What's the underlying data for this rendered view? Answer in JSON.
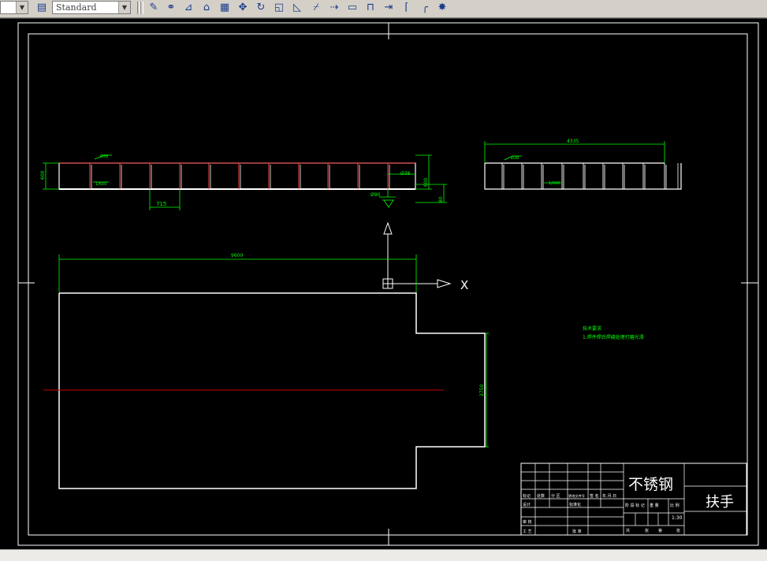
{
  "toolbar": {
    "text_style_value": "Standard",
    "icons": [
      "text-style-icon",
      "edit-icon",
      "copy-icon",
      "mirror-icon",
      "offset-icon",
      "array-icon",
      "move-icon",
      "rotate-icon",
      "scale-icon",
      "stretch-icon",
      "trim-icon",
      "extend-icon",
      "break-icon",
      "join-icon",
      "chamfer-icon",
      "fillet-icon",
      "explode-icon"
    ]
  },
  "drawing": {
    "top_view_labels": {
      "spacing": "715",
      "height_left": "600",
      "pipe_top": "Ø38",
      "slope": "1/600",
      "pipe_side": "Ø38",
      "pipe_bottom": "Ø90",
      "height_right": "600",
      "height_end": "80"
    },
    "side_view_labels": {
      "length": "4335",
      "pipe_top": "Ø38",
      "slope": "1/600"
    },
    "plan_labels": {
      "length": "9600",
      "width": "2750"
    },
    "ucs": {
      "x_label": "X"
    },
    "notes": {
      "title": "技术要求",
      "line1": "1.焊件焊后焊缝处理打磨光滑"
    },
    "title_block": {
      "material": "不锈钢",
      "part_name": "扶手",
      "scale": "1:30",
      "header_cells": [
        "标记",
        "处数",
        "分 区",
        "更改文件号",
        "签 名",
        "年.月.日"
      ],
      "row_design": "设计",
      "row_standard": "标准化",
      "stage_cells": [
        "阶 段 标 记",
        "重 量",
        "比 例"
      ],
      "row_review": "审 核",
      "row_process": "工 艺",
      "row_approve": "批 准",
      "sheet_cells": [
        "共",
        "张",
        "第",
        "张"
      ]
    }
  },
  "colors": {
    "canvas": "#000000",
    "outline": "#ffffff",
    "dimension": "#00ff00",
    "weld": "#ff4040",
    "centerline": "#c00000"
  }
}
